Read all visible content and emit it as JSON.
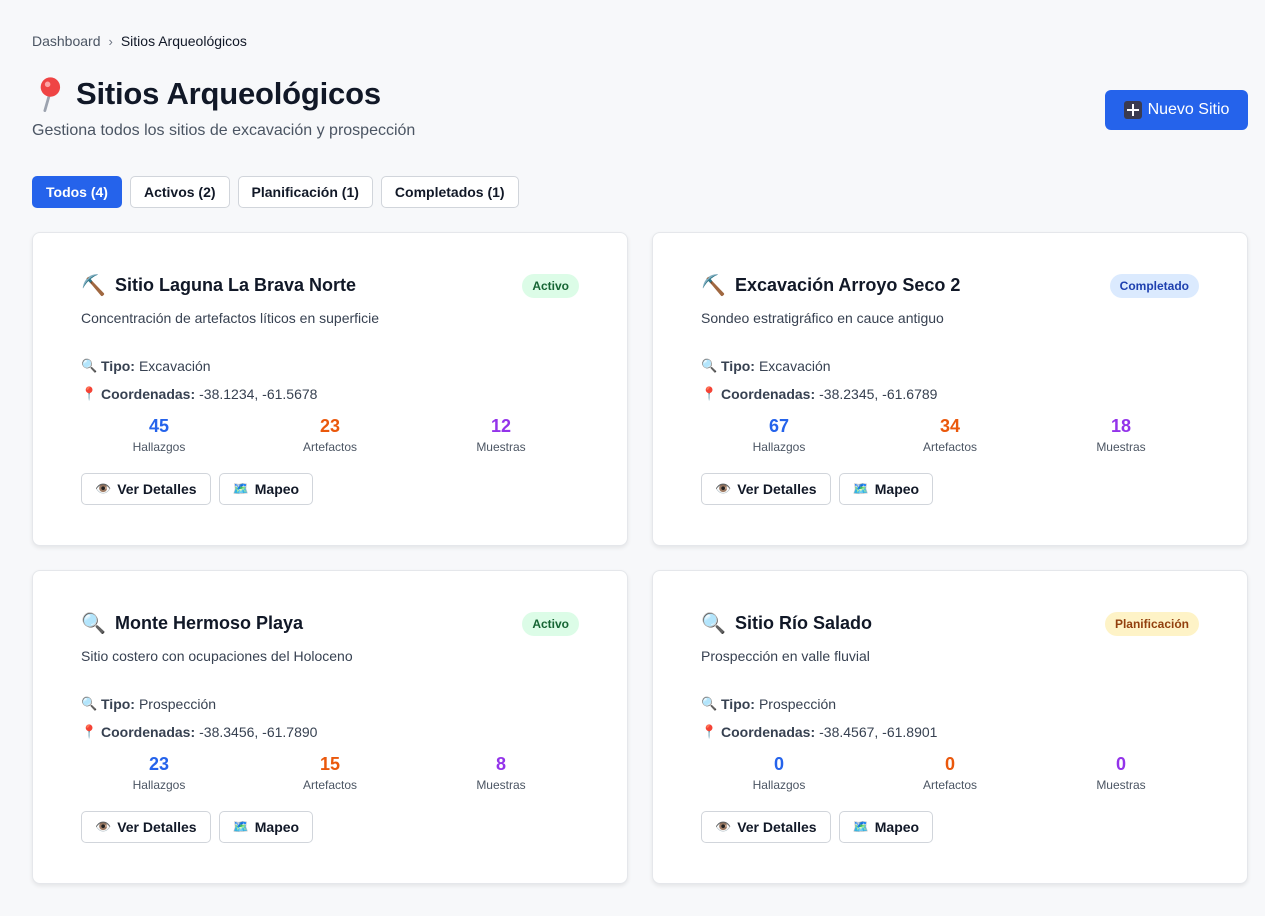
{
  "breadcrumb": {
    "root": "Dashboard",
    "separator": "›",
    "current": "Sitios Arqueológicos"
  },
  "page": {
    "title": "Sitios Arqueológicos",
    "subtitle": "Gestiona todos los sitios de excavación y prospección",
    "new_button": "Nuevo Sitio"
  },
  "filters": [
    {
      "label": "Todos (4)",
      "active": true
    },
    {
      "label": "Activos (2)",
      "active": false
    },
    {
      "label": "Planificación (1)",
      "active": false
    },
    {
      "label": "Completados (1)",
      "active": false
    }
  ],
  "labels": {
    "tipo": "Tipo:",
    "coordenadas": "Coordenadas:",
    "hallazgos": "Hallazgos",
    "artefactos": "Artefactos",
    "muestras": "Muestras",
    "ver_detalles": "Ver Detalles",
    "mapeo": "Mapeo"
  },
  "sites": [
    {
      "icon": "⛏️",
      "icon_name": "pickaxe-icon",
      "name": "Sitio Laguna La Brava Norte",
      "status": "Activo",
      "description": "Concentración de artefactos líticos en superficie",
      "tipo": "Excavación",
      "coordenadas": "-38.1234, -61.5678",
      "hallazgos": "45",
      "artefactos": "23",
      "muestras": "12"
    },
    {
      "icon": "⛏️",
      "icon_name": "pickaxe-icon",
      "name": "Excavación Arroyo Seco 2",
      "status": "Completado",
      "description": "Sondeo estratigráfico en cauce antiguo",
      "tipo": "Excavación",
      "coordenadas": "-38.2345, -61.6789",
      "hallazgos": "67",
      "artefactos": "34",
      "muestras": "18"
    },
    {
      "icon": "🔍",
      "icon_name": "magnifier-icon",
      "name": "Monte Hermoso Playa",
      "status": "Activo",
      "description": "Sitio costero con ocupaciones del Holoceno",
      "tipo": "Prospección",
      "coordenadas": "-38.3456, -61.7890",
      "hallazgos": "23",
      "artefactos": "15",
      "muestras": "8"
    },
    {
      "icon": "🔍",
      "icon_name": "magnifier-icon",
      "name": "Sitio Río Salado",
      "status": "Planificación",
      "description": "Prospección en valle fluvial",
      "tipo": "Prospección",
      "coordenadas": "-38.4567, -61.8901",
      "hallazgos": "0",
      "artefactos": "0",
      "muestras": "0"
    }
  ],
  "icons": {
    "meta_tipo": "🔍",
    "meta_coordenadas": "📍",
    "ver_detalles": "👁️",
    "mapeo": "🗺️"
  }
}
